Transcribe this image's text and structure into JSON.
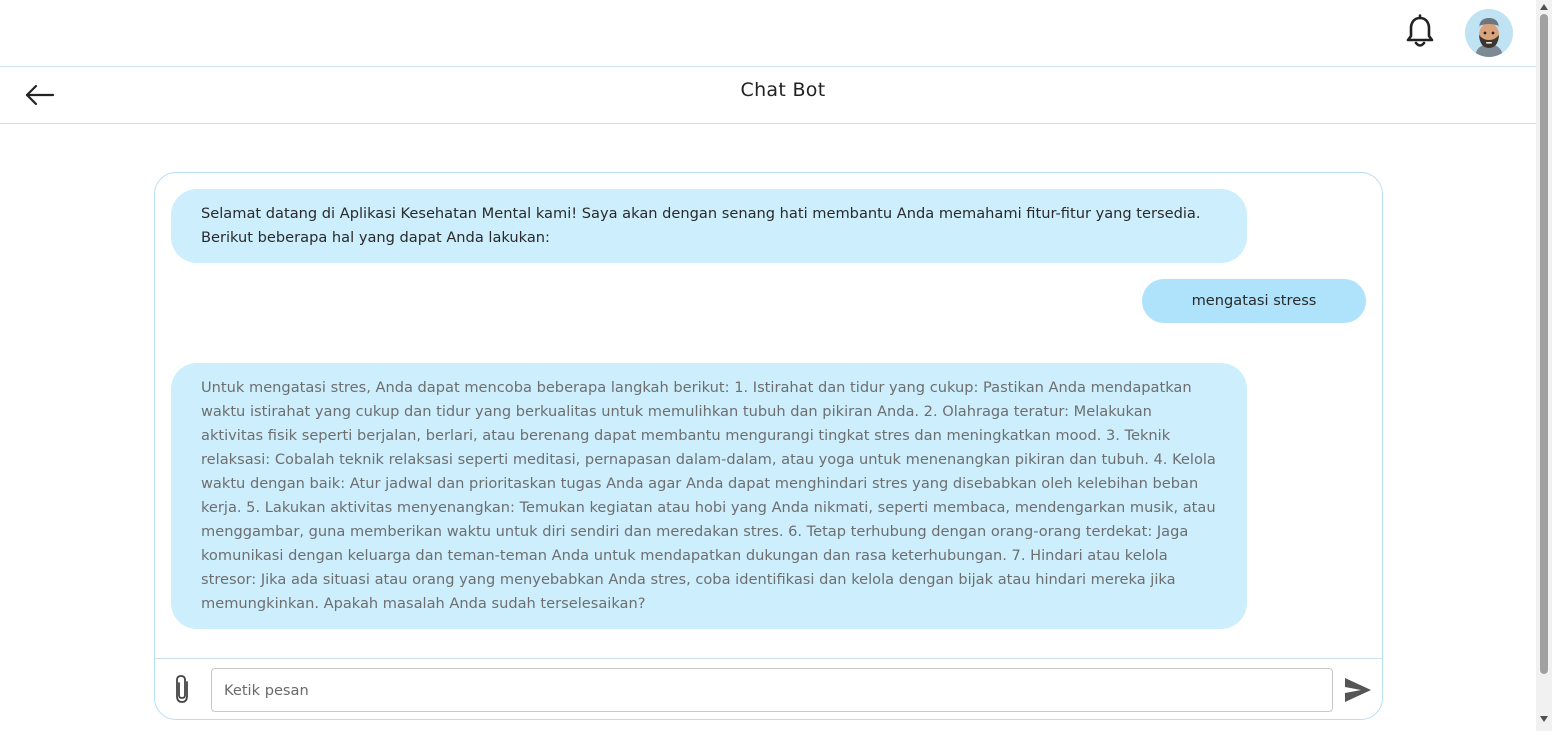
{
  "header": {
    "notification_icon": "bell-icon",
    "avatar_icon": "user-avatar"
  },
  "subheader": {
    "back_icon": "arrow-left-icon",
    "title": "Chat Bot"
  },
  "chat": {
    "messages": [
      {
        "sender": "bot",
        "text": "Selamat datang di Aplikasi Kesehatan Mental kami! Saya akan dengan senang hati membantu Anda memahami fitur-fitur yang tersedia. Berikut beberapa hal yang dapat Anda lakukan:"
      },
      {
        "sender": "user",
        "text": "mengatasi stress"
      },
      {
        "sender": "bot",
        "text": "Untuk mengatasi stres, Anda dapat mencoba beberapa langkah berikut: 1. Istirahat dan tidur yang cukup: Pastikan Anda mendapatkan waktu istirahat yang cukup dan tidur yang berkualitas untuk memulihkan tubuh dan pikiran Anda. 2. Olahraga teratur: Melakukan aktivitas fisik seperti berjalan, berlari, atau berenang dapat membantu mengurangi tingkat stres dan meningkatkan mood. 3. Teknik relaksasi: Cobalah teknik relaksasi seperti meditasi, pernapasan dalam-dalam, atau yoga untuk menenangkan pikiran dan tubuh. 4. Kelola waktu dengan baik: Atur jadwal dan prioritaskan tugas Anda agar Anda dapat menghindari stres yang disebabkan oleh kelebihan beban kerja. 5. Lakukan aktivitas menyenangkan: Temukan kegiatan atau hobi yang Anda nikmati, seperti membaca, mendengarkan musik, atau menggambar, guna memberikan waktu untuk diri sendiri dan meredakan stres. 6. Tetap terhubung dengan orang-orang terdekat: Jaga komunikasi dengan keluarga dan teman-teman Anda untuk mendapatkan dukungan dan rasa keterhubungan. 7. Hindari atau kelola stresor: Jika ada situasi atau orang yang menyebabkan Anda stres, coba identifikasi dan kelola dengan bijak atau hindari mereka jika memungkinkan. Apakah masalah Anda sudah terselesaikan?"
      }
    ],
    "input": {
      "placeholder": "Ketik pesan",
      "value": "",
      "attach_icon": "paperclip-icon",
      "send_icon": "send-icon"
    }
  },
  "colors": {
    "bot_bubble": "#cdeffd",
    "user_bubble": "#aee3fb",
    "chat_border": "#b8dcf0"
  }
}
